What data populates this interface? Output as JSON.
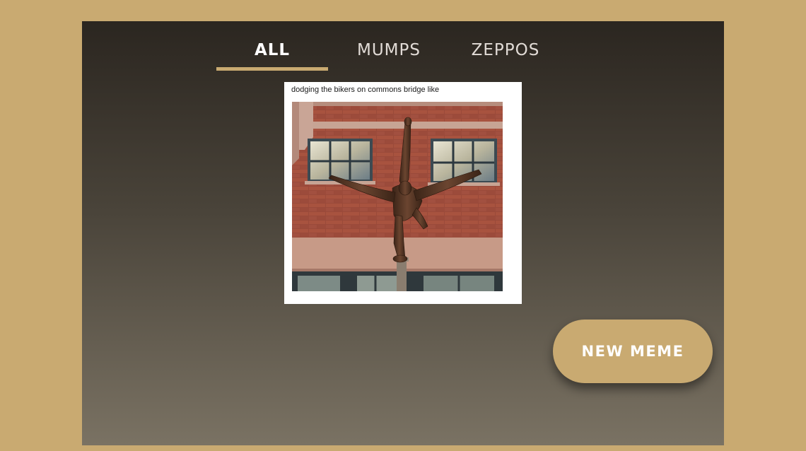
{
  "tabs": [
    {
      "label": "ALL",
      "active": true
    },
    {
      "label": "MUMPS",
      "active": false
    },
    {
      "label": "ZEPPOS",
      "active": false
    }
  ],
  "meme": {
    "caption": "dodging the bikers on commons bridge like",
    "image_subject": "bronze gymnast statue doing a split handstand in front of a brick building"
  },
  "actions": {
    "new_meme_label": "NEW MEME"
  },
  "colors": {
    "accent_gold": "#c9aa71",
    "panel_top": "#2b2620",
    "panel_bottom": "#7a7263",
    "tab_text": "#e1dbd6"
  }
}
